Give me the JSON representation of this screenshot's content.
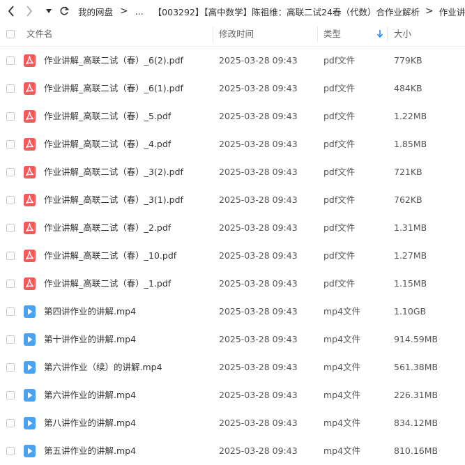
{
  "breadcrumb": {
    "items": [
      "我的网盘",
      "...",
      "【003292】【高中数学】陈祖维：高联二试24春（代数）合作业解析",
      "作业讲解"
    ]
  },
  "columns": {
    "name": "文件名",
    "modified": "修改时间",
    "type": "类型",
    "size": "大小"
  },
  "colors": {
    "pdf_icon": "#f05a5a",
    "video_icon": "#4aa3f0",
    "sort_arrow": "#1a8cff"
  },
  "files": [
    {
      "icon": "pdf-icon",
      "name": "作业讲解_高联二试（春）_6(2).pdf",
      "modified": "2025-03-28 09:43",
      "type": "pdf文件",
      "size": "779KB"
    },
    {
      "icon": "pdf-icon",
      "name": "作业讲解_高联二试（春）_6(1).pdf",
      "modified": "2025-03-28 09:43",
      "type": "pdf文件",
      "size": "484KB"
    },
    {
      "icon": "pdf-icon",
      "name": "作业讲解_高联二试（春）_5.pdf",
      "modified": "2025-03-28 09:43",
      "type": "pdf文件",
      "size": "1.22MB"
    },
    {
      "icon": "pdf-icon",
      "name": "作业讲解_高联二试（春）_4.pdf",
      "modified": "2025-03-28 09:43",
      "type": "pdf文件",
      "size": "1.85MB"
    },
    {
      "icon": "pdf-icon",
      "name": "作业讲解_高联二试（春）_3(2).pdf",
      "modified": "2025-03-28 09:43",
      "type": "pdf文件",
      "size": "721KB"
    },
    {
      "icon": "pdf-icon",
      "name": "作业讲解_高联二试（春）_3(1).pdf",
      "modified": "2025-03-28 09:43",
      "type": "pdf文件",
      "size": "762KB"
    },
    {
      "icon": "pdf-icon",
      "name": "作业讲解_高联二试（春）_2.pdf",
      "modified": "2025-03-28 09:43",
      "type": "pdf文件",
      "size": "1.31MB"
    },
    {
      "icon": "pdf-icon",
      "name": "作业讲解_高联二试（春）_10.pdf",
      "modified": "2025-03-28 09:43",
      "type": "pdf文件",
      "size": "1.27MB"
    },
    {
      "icon": "pdf-icon",
      "name": "作业讲解_高联二试（春）_1.pdf",
      "modified": "2025-03-28 09:43",
      "type": "pdf文件",
      "size": "1.15MB"
    },
    {
      "icon": "video-icon",
      "name": "第四讲作业的讲解.mp4",
      "modified": "2025-03-28 09:43",
      "type": "mp4文件",
      "size": "1.10GB"
    },
    {
      "icon": "video-icon",
      "name": "第十讲作业的讲解.mp4",
      "modified": "2025-03-28 09:43",
      "type": "mp4文件",
      "size": "914.59MB"
    },
    {
      "icon": "video-icon",
      "name": "第六讲作业（续）的讲解.mp4",
      "modified": "2025-03-28 09:43",
      "type": "mp4文件",
      "size": "561.38MB"
    },
    {
      "icon": "video-icon",
      "name": "第六讲作业的讲解.mp4",
      "modified": "2025-03-28 09:43",
      "type": "mp4文件",
      "size": "226.31MB"
    },
    {
      "icon": "video-icon",
      "name": "第八讲作业的讲解.mp4",
      "modified": "2025-03-28 09:43",
      "type": "mp4文件",
      "size": "834.12MB"
    },
    {
      "icon": "video-icon",
      "name": "第五讲作业的讲解.mp4",
      "modified": "2025-03-28 09:43",
      "type": "mp4文件",
      "size": "810.16MB"
    }
  ]
}
